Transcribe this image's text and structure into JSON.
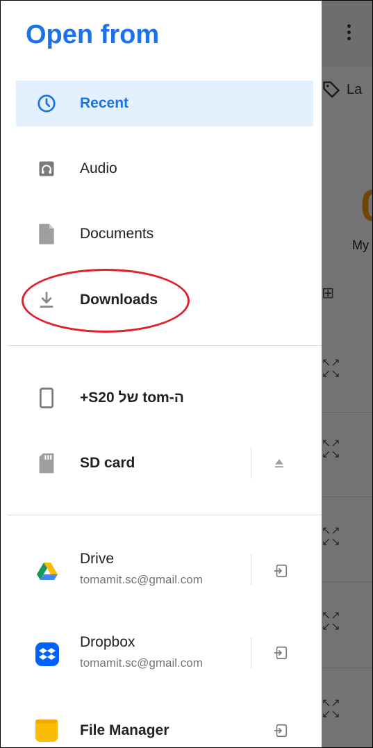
{
  "background": {
    "chip_label": "La",
    "big_value": "0",
    "big_caption": "My"
  },
  "drawer": {
    "title": "Open from",
    "places": [
      {
        "label": "Recent",
        "icon": "clock-icon",
        "selected": true
      },
      {
        "label": "Audio",
        "icon": "audio-icon",
        "selected": false
      },
      {
        "label": "Documents",
        "icon": "document-icon",
        "selected": false
      },
      {
        "label": "Downloads",
        "icon": "download-icon",
        "selected": false
      }
    ],
    "devices": [
      {
        "label": "+S20 של tom-ה",
        "icon": "phone-icon"
      },
      {
        "label": "SD card",
        "icon": "sd-card-icon",
        "action_icon": "eject-icon"
      }
    ],
    "accounts": [
      {
        "name": "Drive",
        "email": "tomamit.sc@gmail.com",
        "icon": "google-drive-icon"
      },
      {
        "name": "Dropbox",
        "email": "tomamit.sc@gmail.com",
        "icon": "dropbox-icon"
      },
      {
        "name": "File Manager",
        "email": "",
        "icon": "file-manager-icon"
      }
    ]
  },
  "colors": {
    "accent": "#1a73e8",
    "selected_bg": "#e3f0fd",
    "annotation": "#e0202a"
  }
}
